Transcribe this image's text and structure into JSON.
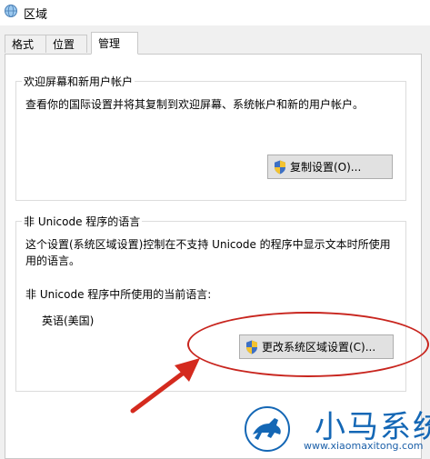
{
  "window": {
    "title": "区域",
    "icon": "globe-icon"
  },
  "tabs": [
    {
      "label": "格式",
      "selected": false
    },
    {
      "label": "位置",
      "selected": false
    },
    {
      "label": "管理",
      "selected": true
    }
  ],
  "welcome_group": {
    "title": "欢迎屏幕和新用户帐户",
    "description": "查看你的国际设置并将其复制到欢迎屏幕、系统帐户和新的用户帐户。",
    "copy_button": "复制设置(O)...",
    "button_icon": "shield-icon"
  },
  "nonunicode_group": {
    "title": "非 Unicode 程序的语言",
    "description_line1": "这个设置(系统区域设置)控制在不支持 Unicode 的程序中显示文本时所使用",
    "description_line2": "用的语言。",
    "current_label": "非 Unicode 程序中所使用的当前语言:",
    "current_value": "英语(美国)",
    "change_button": "更改系统区域设置(C)...",
    "button_icon": "shield-icon"
  },
  "annotation": {
    "highlight_color": "#c8251e"
  },
  "watermark": {
    "title": "小马系统",
    "url": "www.xiaomaxitong.com",
    "color": "#1467b5",
    "icon": "horse-icon"
  }
}
